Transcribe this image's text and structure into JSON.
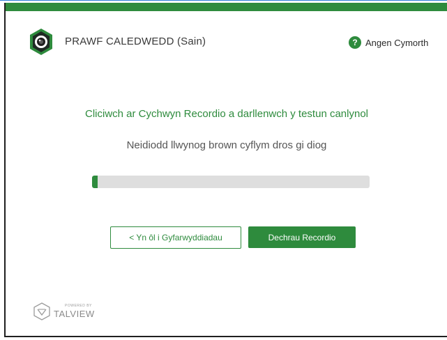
{
  "header": {
    "title": "PRAWF CALEDWEDD (Sain)",
    "help_label": "Angen Cymorth",
    "help_icon_glyph": "?",
    "logo_icon": "webcam-icon"
  },
  "main": {
    "instruction": "Cliciwch ar Cychwyn Recordio a darllenwch y testun canlynol",
    "sample_text": "Neidiodd llwynog brown cyflym dros gi diog",
    "level_percent": 2
  },
  "actions": {
    "back_label": "< Yn ôl i Gyfarwyddiadau",
    "record_label": "Dechrau Recordio"
  },
  "footer": {
    "powered_by": "POWERED BY",
    "brand": "TALVIEW"
  },
  "colors": {
    "accent": "#2e8b3d",
    "track": "#dedede"
  }
}
